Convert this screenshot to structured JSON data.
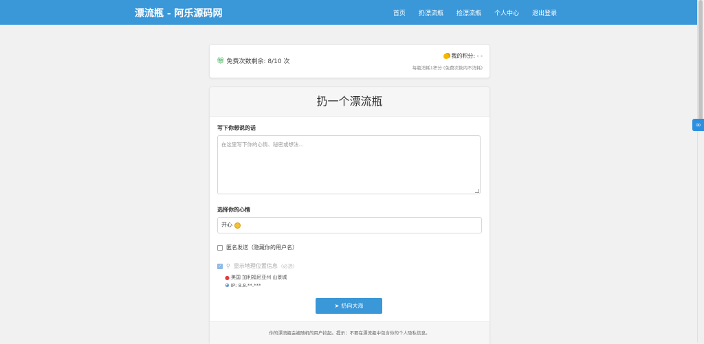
{
  "navbar": {
    "brand": "漂流瓶 - 阿乐源码网",
    "links": [
      "首页",
      "扔漂流瓶",
      "捡漂流瓶",
      "个人中心",
      "退出登录"
    ]
  },
  "stats": {
    "free_label": "免费次数剩余: 8/10 次",
    "points_label": "我的积分: - -",
    "points_note": "每瓶消耗1积分 (免费次数内不消耗)"
  },
  "form": {
    "title": "扔一个漂流瓶",
    "message_label": "写下你想说的话",
    "message_placeholder": "在这里写下你的心情、秘密或想法...",
    "mood_label": "选择你的心情",
    "mood_value": "开心",
    "anonymous_label": "匿名发送（隐藏你的用户名）",
    "location_label": "显示地理位置信息",
    "location_hint": "(必选)",
    "location_value": "美国 加利福尼亚州 山景城",
    "ip_value": "IP: 8.8.**.***",
    "submit_label": "扔向大海",
    "footer_note": "你的漂流瓶会被随机的用户捡起。提示：不要在漂流瓶中包含你的个人隐私信息。"
  },
  "colors": {
    "primary": "#3a97d8",
    "background": "#f1f1f1"
  }
}
